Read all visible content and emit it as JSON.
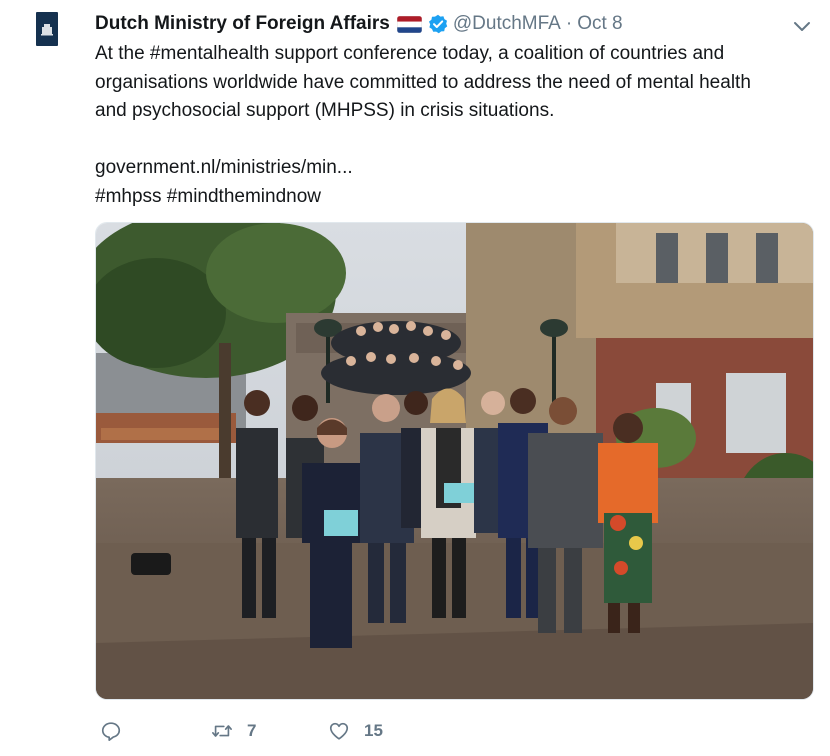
{
  "tweet": {
    "author_name": "Dutch Ministry of Foreign Affairs",
    "flag_icon": "netherlands-flag-icon",
    "handle": "@DutchMFA",
    "separator": "·",
    "date": "Oct 8",
    "text_lines": [
      "At the #mentalhealth support conference today, a coalition of countries and",
      "organisations worldwide have committed to address the need of mental health",
      "and psychosocial support (MHPSS) in crisis situations."
    ],
    "link": "government.nl/ministries/min...",
    "hashtags": "#mhpss #mindthemindnow"
  },
  "actions": {
    "reply_count": "",
    "retweet_count": "7",
    "like_count": "15"
  },
  "colors": {
    "text": "#14171a",
    "secondary": "#657786",
    "verified_blue": "#1da1f2",
    "avatar_navy": "#15314f"
  }
}
